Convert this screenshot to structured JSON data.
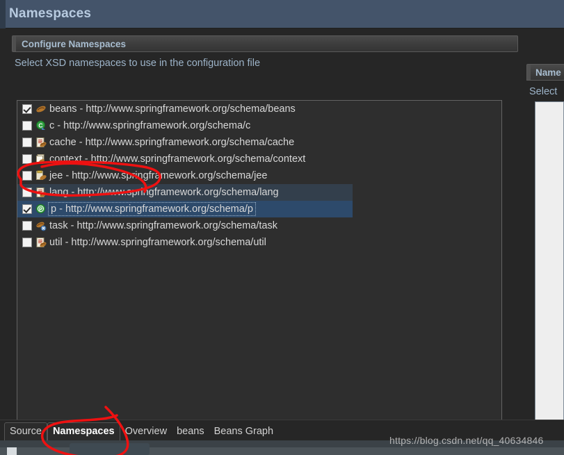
{
  "window": {
    "title": "Namespaces"
  },
  "section": {
    "header": "Configure Namespaces",
    "description": "Select XSD namespaces to use in the configuration file"
  },
  "right_panel": {
    "header": "Name",
    "description": "Select"
  },
  "namespaces": [
    {
      "checked": true,
      "icon": "beans-icon",
      "text": "beans - http://www.springframework.org/schema/beans",
      "state": "normal"
    },
    {
      "checked": false,
      "icon": "c-icon",
      "text": "c - http://www.springframework.org/schema/c",
      "state": "normal"
    },
    {
      "checked": false,
      "icon": "cache-icon",
      "text": "cache - http://www.springframework.org/schema/cache",
      "state": "normal"
    },
    {
      "checked": false,
      "icon": "context-icon",
      "text": "context - http://www.springframework.org/schema/context",
      "state": "normal"
    },
    {
      "checked": false,
      "icon": "jee-icon",
      "text": "jee - http://www.springframework.org/schema/jee",
      "state": "normal"
    },
    {
      "checked": false,
      "icon": "lang-icon",
      "text": "lang - http://www.springframework.org/schema/lang",
      "state": "hover"
    },
    {
      "checked": true,
      "icon": "p-icon",
      "text": "p - http://www.springframework.org/schema/p",
      "state": "selected"
    },
    {
      "checked": false,
      "icon": "task-icon",
      "text": "task - http://www.springframework.org/schema/task",
      "state": "normal"
    },
    {
      "checked": false,
      "icon": "util-icon",
      "text": "util - http://www.springframework.org/schema/util",
      "state": "normal"
    }
  ],
  "tabs": [
    {
      "label": "Source",
      "active": false
    },
    {
      "label": "Namespaces",
      "active": true
    },
    {
      "label": "Overview",
      "active": false
    },
    {
      "label": "beans",
      "active": false
    },
    {
      "label": "Beans Graph",
      "active": false
    }
  ],
  "watermark": "https://blog.csdn.net/qq_40634846",
  "colors": {
    "titlebar": "#44546a",
    "title_text": "#b8cbe0",
    "background": "#262626",
    "selected_row": "#2d4a6b",
    "hover_row": "#333f4c",
    "annotation": "#ee1111",
    "section_label": "#a8bdd0"
  }
}
